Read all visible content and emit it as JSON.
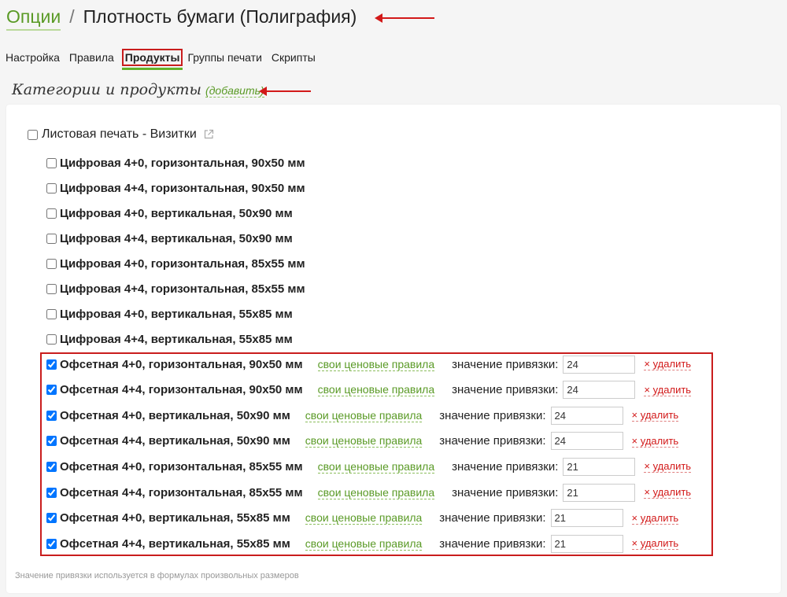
{
  "breadcrumb": {
    "parent": "Опции",
    "separator": "/",
    "title": "Плотность бумаги (Полиграфия)"
  },
  "tabs": [
    {
      "label": "Настройка"
    },
    {
      "label": "Правила"
    },
    {
      "label": "Продукты",
      "active": true
    },
    {
      "label": "Группы печати"
    },
    {
      "label": "Скрипты"
    }
  ],
  "section": {
    "title": "Категории и продукты",
    "add_link": "(добавить)"
  },
  "category": {
    "label": "Листовая печать - Визитки",
    "checked": false
  },
  "products_unchecked": [
    {
      "label": "Цифровая 4+0, горизонтальная, 90x50 мм"
    },
    {
      "label": "Цифровая 4+4, горизонтальная, 90x50 мм"
    },
    {
      "label": "Цифровая 4+0, вертикальная, 50x90 мм"
    },
    {
      "label": "Цифровая 4+4, вертикальная, 50x90 мм"
    },
    {
      "label": "Цифровая 4+0, горизонтальная, 85x55 мм"
    },
    {
      "label": "Цифровая 4+4, горизонтальная, 85x55 мм"
    },
    {
      "label": "Цифровая 4+0, вертикальная, 55x85 мм"
    },
    {
      "label": "Цифровая 4+4, вертикальная, 55x85 мм"
    }
  ],
  "products_checked": [
    {
      "label": "Офсетная 4+0, горизонтальная, 90x50 мм",
      "value": "24"
    },
    {
      "label": "Офсетная 4+4, горизонтальная, 90x50 мм",
      "value": "24"
    },
    {
      "label": "Офсетная 4+0, вертикальная, 50x90 мм",
      "value": "24"
    },
    {
      "label": "Офсетная 4+4, вертикальная, 50x90 мм",
      "value": "24"
    },
    {
      "label": "Офсетная 4+0, горизонтальная, 85x55 мм",
      "value": "21"
    },
    {
      "label": "Офсетная 4+4, горизонтальная, 85x55 мм",
      "value": "21"
    },
    {
      "label": "Офсетная 4+0, вертикальная, 55x85 мм",
      "value": "21"
    },
    {
      "label": "Офсетная 4+4, вертикальная, 55x85 мм",
      "value": "21"
    }
  ],
  "row_texts": {
    "rules_link": "свои ценовые правила",
    "bind_label": "значение привязки:",
    "delete_link": "× удалить"
  },
  "footnote": "Значение привязки используется в формулах произвольных размеров",
  "colors": {
    "accent_green": "#5a9a26",
    "annotation_red": "#d21919",
    "tab_underline": "#63b229"
  },
  "icons": {
    "category_external": "external-link-icon"
  }
}
